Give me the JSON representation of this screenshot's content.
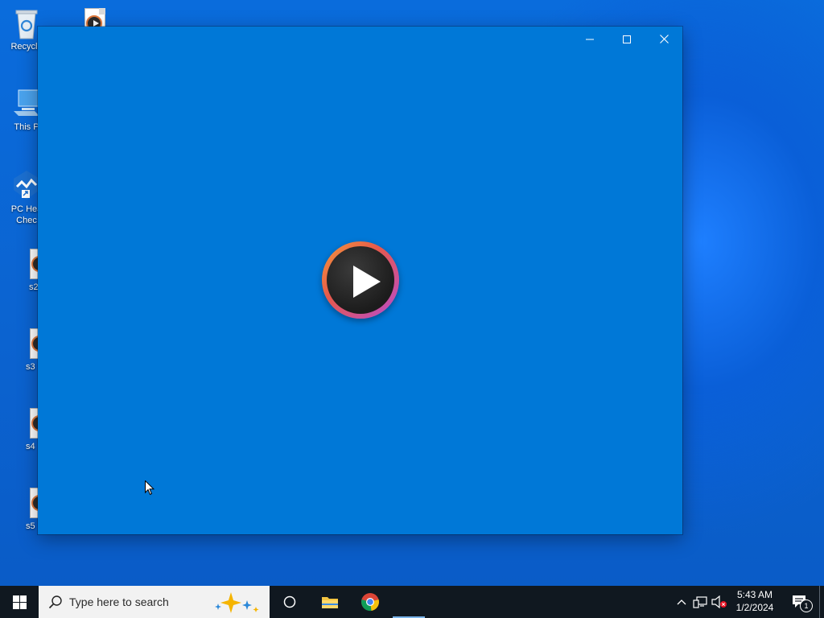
{
  "desktop": {
    "icons": [
      {
        "label": "Recycle",
        "icon": "recycle-bin-icon"
      },
      {
        "label": "This P",
        "icon": "this-pc-icon"
      },
      {
        "label": "PC Hea\nChec",
        "icon": "pc-health-check-icon"
      },
      {
        "label": "s2",
        "icon": "video-file-icon"
      },
      {
        "label": "s3",
        "icon": "video-file-icon"
      },
      {
        "label": "s4",
        "icon": "video-file-icon"
      },
      {
        "label": "s5",
        "icon": "video-file-icon"
      }
    ]
  },
  "window": {
    "controls": [
      "minimize",
      "maximize",
      "close"
    ],
    "center_icon": "media-player-play-icon",
    "background_color": "#0078d7"
  },
  "taskbar": {
    "search_placeholder": "Type here to search",
    "pinned": [
      "task-view-icon",
      "file-explorer-icon",
      "chrome-icon"
    ],
    "tray_icons": [
      "chevron-up-icon",
      "network-icon",
      "volume-muted-icon"
    ],
    "clock": {
      "time": "5:43 AM",
      "date": "1/2/2024"
    },
    "notification_count": "1"
  }
}
